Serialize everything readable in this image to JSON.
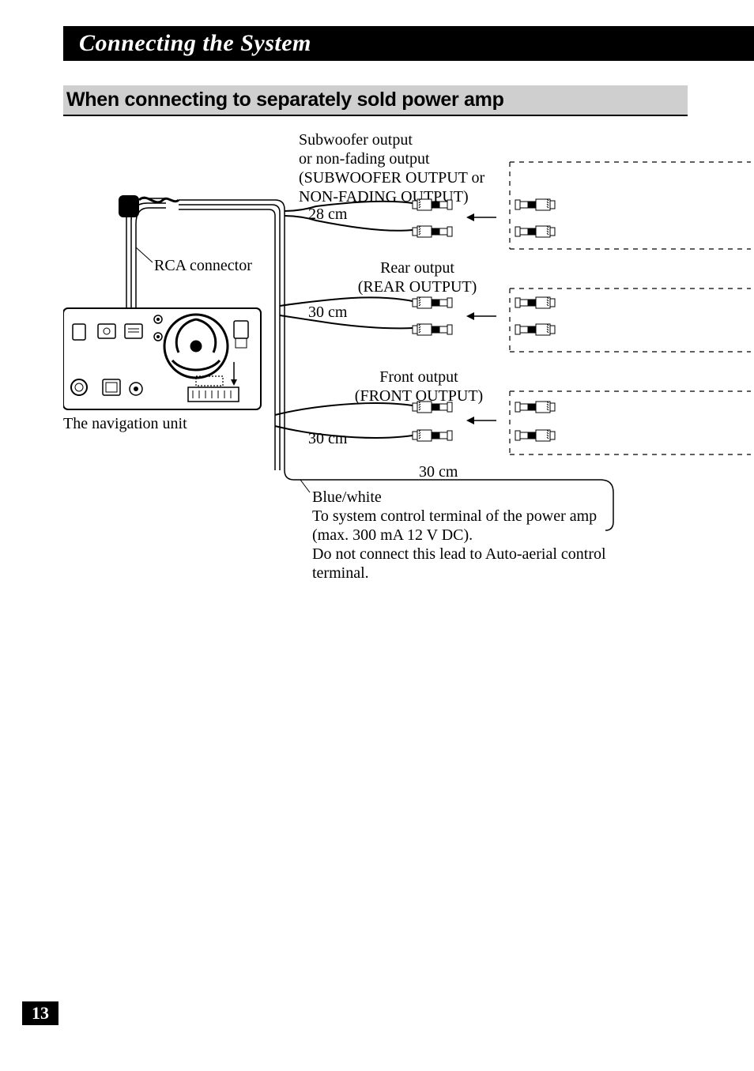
{
  "title": "Connecting the System",
  "section_heading": "When connecting to separately sold power amp",
  "labels": {
    "subwoofer": {
      "line1": "Subwoofer output",
      "line2": "or non-fading output",
      "line3": "(SUBWOOFER OUTPUT or",
      "line4": "NON-FADING OUTPUT)",
      "len": "28 cm"
    },
    "rear": {
      "line1": "Rear output",
      "line2": "(REAR OUTPUT)",
      "len": "30 cm"
    },
    "front": {
      "line1": "Front output",
      "line2": "(FRONT OUTPUT)",
      "len": "30 cm"
    },
    "bottom_len": "30 cm",
    "rca_connector": "RCA connector",
    "nav_unit": "The navigation unit",
    "blue_white": {
      "line1": "Blue/white",
      "line2": "To system control terminal of the power amp",
      "line3": "(max. 300 mA 12 V DC).",
      "line4": "Do not connect this lead to Auto-aerial control",
      "line5": "terminal."
    }
  },
  "page_number": "13"
}
